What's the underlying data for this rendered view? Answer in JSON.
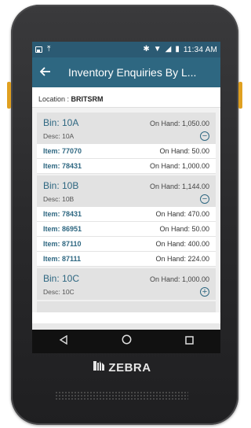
{
  "status_bar": {
    "time": "11:34 AM",
    "icons": [
      "image-icon",
      "upload-icon",
      "bluetooth-icon",
      "wifi-icon",
      "signal-icon",
      "battery-icon"
    ]
  },
  "app_bar": {
    "title": "Inventory Enquiries By L..."
  },
  "location": {
    "label": "Location :",
    "value": "BRITSRM"
  },
  "bins": [
    {
      "title": "Bin: 10A",
      "on_hand": "On Hand: 1,050.00",
      "desc": "Desc: 10A",
      "toggle": "collapse",
      "items": [
        {
          "code": "Item: 77070",
          "on_hand": "On Hand: 50.00"
        },
        {
          "code": "Item: 78431",
          "on_hand": "On Hand: 1,000.00"
        }
      ]
    },
    {
      "title": "Bin: 10B",
      "on_hand": "On Hand: 1,144.00",
      "desc": "Desc: 10B",
      "toggle": "collapse",
      "items": [
        {
          "code": "Item: 78431",
          "on_hand": "On Hand: 470.00"
        },
        {
          "code": "Item: 86951",
          "on_hand": "On Hand: 50.00"
        },
        {
          "code": "Item: 87110",
          "on_hand": "On Hand: 400.00"
        },
        {
          "code": "Item: 87111",
          "on_hand": "On Hand: 224.00"
        }
      ]
    },
    {
      "title": "Bin: 10C",
      "on_hand": "On Hand: 1,000.00",
      "desc": "Desc: 10C",
      "toggle": "expand",
      "items": []
    }
  ],
  "nav": {
    "icons": [
      "back-icon",
      "home-icon",
      "recents-icon"
    ]
  },
  "brand": {
    "name": "ZEBRA"
  },
  "colors": {
    "status_bar": "#2b5a73",
    "app_bar": "#2e6781",
    "accent": "#2e6781",
    "bin_bg": "#e2e2e2",
    "device": "#2a2a2c",
    "side_button": "#e0a020"
  }
}
